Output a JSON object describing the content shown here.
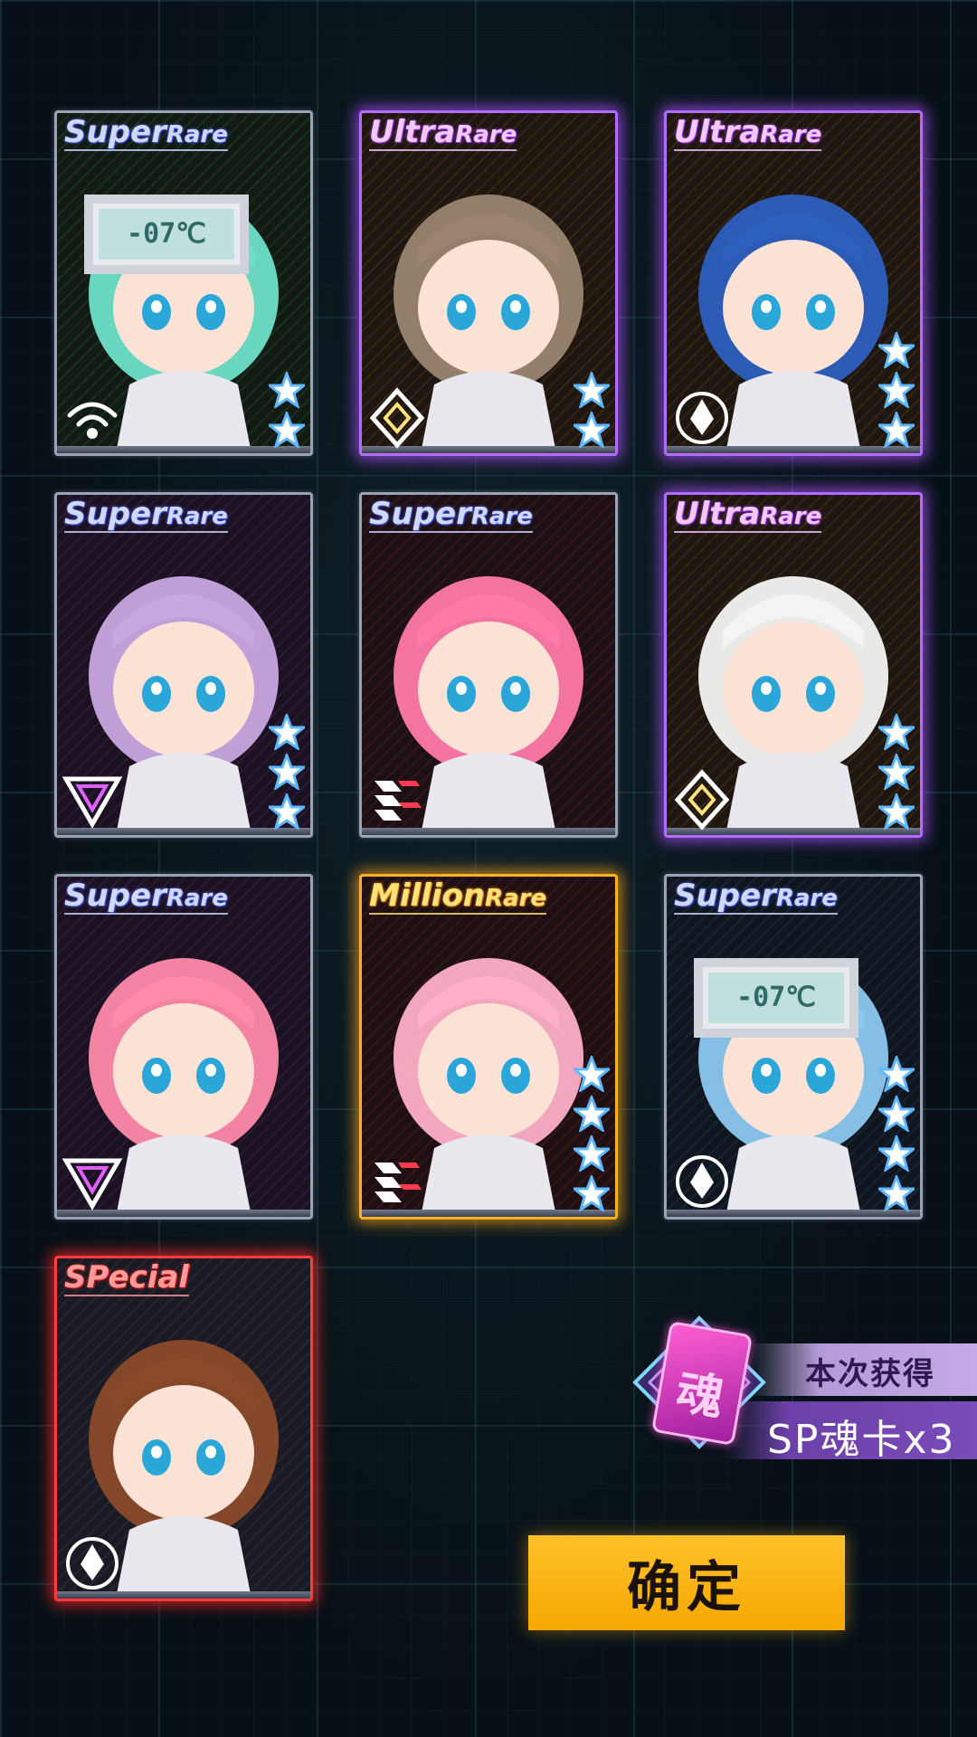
{
  "cards": [
    {
      "rarity_word1": "Super",
      "rarity_word2": "Rare",
      "rarity": "sr",
      "stars": 2,
      "faction": "wifi-faction-icon",
      "art_text": "-07℃",
      "hair": "#6fe0c8"
    },
    {
      "rarity_word1": "Ultra",
      "rarity_word2": "Rare",
      "rarity": "ur",
      "stars": 2,
      "faction": "diamond-faction-icon",
      "hair": "#9a8470"
    },
    {
      "rarity_word1": "Ultra",
      "rarity_word2": "Rare",
      "rarity": "ur",
      "stars": 3,
      "faction": "drop-faction-icon",
      "hair": "#2d5fbf"
    },
    {
      "rarity_word1": "Super",
      "rarity_word2": "Rare",
      "rarity": "sr",
      "stars": 3,
      "faction": "triangle-faction-icon",
      "hair": "#c8a8e0"
    },
    {
      "rarity_word1": "Super",
      "rarity_word2": "Rare",
      "rarity": "sr",
      "stars": 0,
      "faction": "chevron-faction-icon",
      "hair": "#ff7aa8"
    },
    {
      "rarity_word1": "Ultra",
      "rarity_word2": "Rare",
      "rarity": "ur",
      "stars": 3,
      "faction": "diamond-faction-icon",
      "hair": "#f4f4f4"
    },
    {
      "rarity_word1": "Super",
      "rarity_word2": "Rare",
      "rarity": "sr",
      "stars": 0,
      "faction": "triangle-faction-icon",
      "hair": "#ff8aaa"
    },
    {
      "rarity_word1": "Million",
      "rarity_word2": "Rare",
      "rarity": "mr",
      "stars": 4,
      "faction": "chevron-faction-icon",
      "hair": "#ffb0c8"
    },
    {
      "rarity_word1": "Super",
      "rarity_word2": "Rare",
      "rarity": "sr",
      "stars": 4,
      "faction": "drop-faction-icon",
      "art_text": "-07℃",
      "hair": "#8cc8f0"
    },
    {
      "rarity_word1": "SPecial",
      "rarity_word2": "",
      "rarity": "sp",
      "stars": 0,
      "faction": "drop-faction-icon",
      "hair": "#8a4a2a"
    }
  ],
  "reward": {
    "soul_char": "魂",
    "obtained_label": "本次获得",
    "item_label": "SP魂卡x3"
  },
  "confirm_button": "确定",
  "colors": {
    "accent": "#f5a800",
    "ur_glow": "#b46bff",
    "mr_glow": "#ffb020",
    "sp_glow": "#ff3b3b"
  }
}
